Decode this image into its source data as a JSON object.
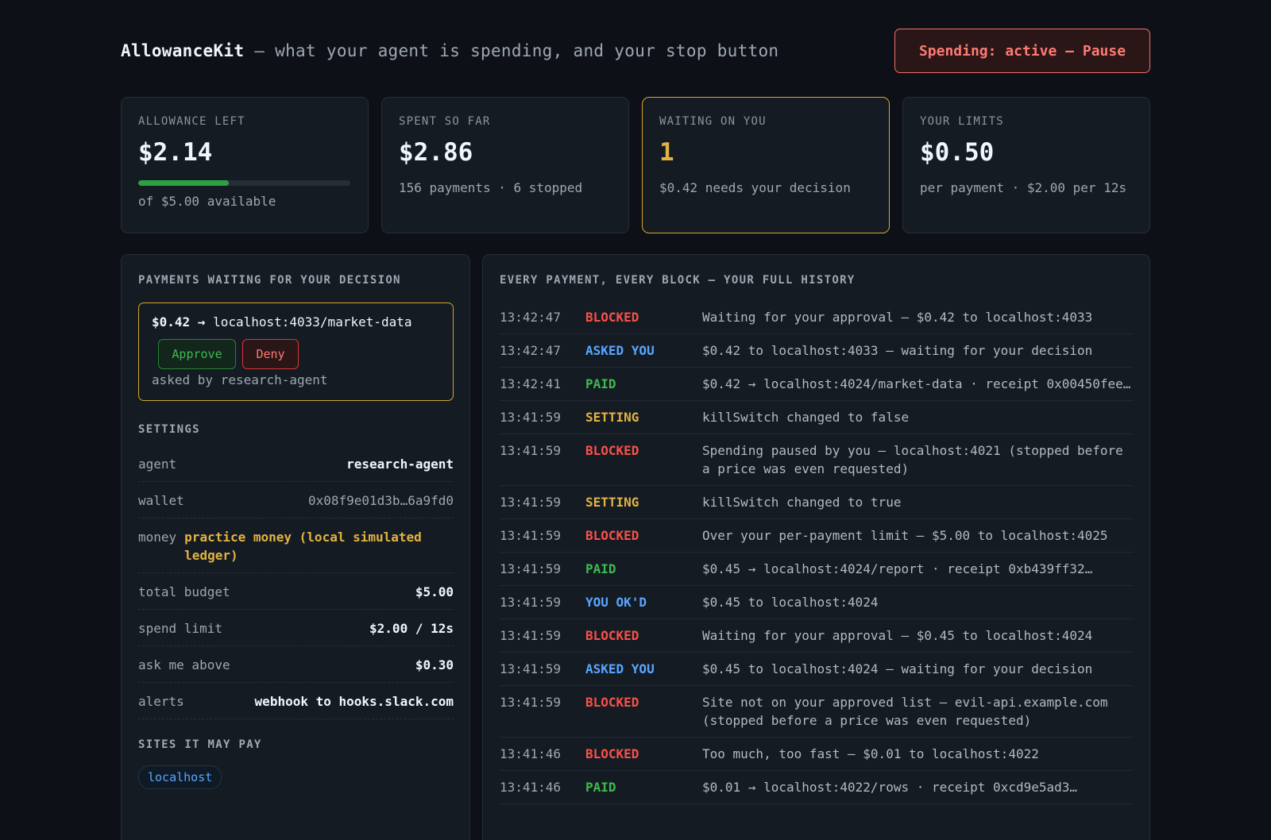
{
  "header": {
    "app_name": "AllowanceKit",
    "tagline": " — what your agent is spending, and your stop button",
    "pause_label": "Spending: active — Pause"
  },
  "stats": {
    "allowance": {
      "label": "ALLOWANCE LEFT",
      "value": "$2.14",
      "progress_fraction": 0.428,
      "sub": "of $5.00 available"
    },
    "spent": {
      "label": "SPENT SO FAR",
      "value": "$2.86",
      "sub": "156 payments · 6 stopped"
    },
    "waiting": {
      "label": "WAITING ON YOU",
      "value": "1",
      "sub": "$0.42 needs your decision"
    },
    "limits": {
      "label": "YOUR LIMITS",
      "value": "$0.50",
      "sub": "per payment · $2.00 per 12s"
    }
  },
  "pending_panel": {
    "title": "PAYMENTS WAITING FOR YOUR DECISION",
    "item": {
      "amount": "$0.42 → ",
      "route": "localhost:4033/market-data",
      "approve_label": "Approve",
      "deny_label": "Deny",
      "asked_by": "asked by research-agent"
    }
  },
  "settings": {
    "title": "SETTINGS",
    "agent": {
      "key": "agent",
      "value": "research-agent"
    },
    "wallet": {
      "key": "wallet",
      "value": "0x08f9e01d3b…6a9fd0"
    },
    "money": {
      "key": "money",
      "value": "practice money (local simulated ledger)"
    },
    "total_budget": {
      "key": "total budget",
      "value": "$5.00"
    },
    "spend_limit": {
      "key": "spend limit",
      "value": "$2.00 / 12s"
    },
    "ask_above": {
      "key": "ask me above",
      "value": "$0.30"
    },
    "alerts": {
      "key": "alerts",
      "value": "webhook to hooks.slack.com"
    }
  },
  "sites": {
    "title": "SITES IT MAY PAY",
    "items": [
      "localhost"
    ]
  },
  "history": {
    "title": "EVERY PAYMENT, EVERY BLOCK — YOUR FULL HISTORY",
    "rows": [
      {
        "time": "13:42:47",
        "status": "BLOCKED",
        "kind": "blocked",
        "message": "Waiting for your approval — $0.42 to localhost:4033"
      },
      {
        "time": "13:42:47",
        "status": "ASKED YOU",
        "kind": "asked",
        "message": "$0.42 to localhost:4033 — waiting for your decision"
      },
      {
        "time": "13:42:41",
        "status": "PAID",
        "kind": "paid",
        "message": "$0.42 → localhost:4024/market-data · receipt 0x00450fee…"
      },
      {
        "time": "13:41:59",
        "status": "SETTING",
        "kind": "setting",
        "message": "killSwitch changed to false"
      },
      {
        "time": "13:41:59",
        "status": "BLOCKED",
        "kind": "blocked",
        "message": "Spending paused by you — localhost:4021 (stopped before a price was even requested)"
      },
      {
        "time": "13:41:59",
        "status": "SETTING",
        "kind": "setting",
        "message": "killSwitch changed to true"
      },
      {
        "time": "13:41:59",
        "status": "BLOCKED",
        "kind": "blocked",
        "message": "Over your per-payment limit — $5.00 to localhost:4025"
      },
      {
        "time": "13:41:59",
        "status": "PAID",
        "kind": "paid",
        "message": "$0.45 → localhost:4024/report · receipt 0xb439ff32…"
      },
      {
        "time": "13:41:59",
        "status": "YOU OK'D",
        "kind": "okd",
        "message": "$0.45 to localhost:4024"
      },
      {
        "time": "13:41:59",
        "status": "BLOCKED",
        "kind": "blocked",
        "message": "Waiting for your approval — $0.45 to localhost:4024"
      },
      {
        "time": "13:41:59",
        "status": "ASKED YOU",
        "kind": "asked",
        "message": "$0.45 to localhost:4024 — waiting for your decision"
      },
      {
        "time": "13:41:59",
        "status": "BLOCKED",
        "kind": "blocked",
        "message": "Site not on your approved list — evil-api.example.com (stopped before a price was even requested)"
      },
      {
        "time": "13:41:46",
        "status": "BLOCKED",
        "kind": "blocked",
        "message": "Too much, too fast — $0.01 to localhost:4022"
      },
      {
        "time": "13:41:46",
        "status": "PAID",
        "kind": "paid",
        "message": "$0.01 → localhost:4022/rows · receipt 0xcd9e5ad3…"
      }
    ]
  },
  "colors": {
    "background": "#0d1117",
    "blocked": "#f85149",
    "asked": "#58a6ff",
    "paid": "#3fb950",
    "setting": "#e3b341",
    "warning_border": "#d4a72c"
  }
}
